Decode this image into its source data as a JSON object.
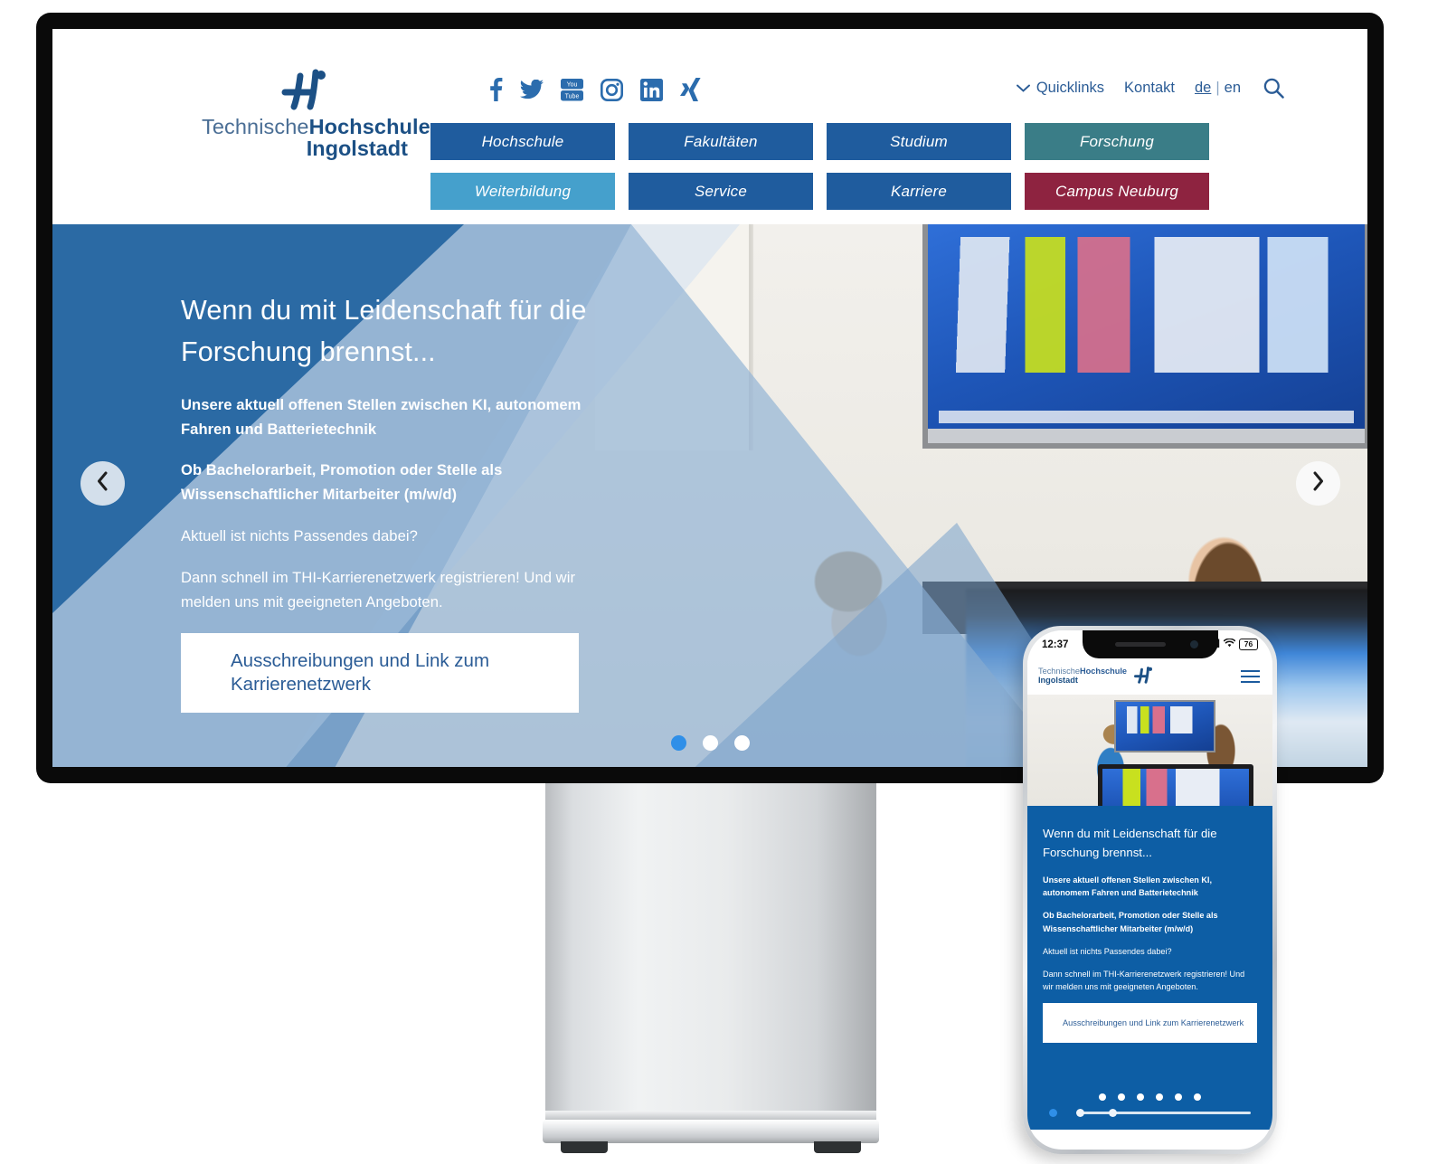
{
  "site": {
    "logo": {
      "line1_thin": "Technische",
      "line1_bold": "Hochschule",
      "line2": "Ingolstadt",
      "mark": "thi-logo-mark"
    },
    "social": [
      {
        "name": "facebook-icon",
        "label": "Facebook"
      },
      {
        "name": "twitter-icon",
        "label": "Twitter"
      },
      {
        "name": "youtube-icon",
        "label": "YouTube"
      },
      {
        "name": "instagram-icon",
        "label": "Instagram"
      },
      {
        "name": "linkedin-icon",
        "label": "LinkedIn"
      },
      {
        "name": "xing-icon",
        "label": "Xing"
      }
    ],
    "utility": {
      "quicklinks": "Quicklinks",
      "kontakt": "Kontakt",
      "lang_de": "de",
      "lang_sep": "|",
      "lang_en": "en",
      "search_icon": "search-icon",
      "chevron_icon": "chevron-down-icon"
    },
    "nav": [
      {
        "label": "Hochschule",
        "color": "#1f5c9e"
      },
      {
        "label": "Fakultäten",
        "color": "#1f5c9e"
      },
      {
        "label": "Studium",
        "color": "#1f5c9e"
      },
      {
        "label": "Forschung",
        "color": "#3a7d87"
      },
      {
        "label": "Weiterbildung",
        "color": "#45a0cc"
      },
      {
        "label": "Service",
        "color": "#1f5c9e"
      },
      {
        "label": "Karriere",
        "color": "#1f5c9e"
      },
      {
        "label": "Campus Neuburg",
        "color": "#8e2340"
      }
    ]
  },
  "hero": {
    "title": "Wenn du mit Leidenschaft für die Forschung brennst...",
    "lead": "Unsere aktuell offenen Stellen zwischen KI, autonomem Fahren und Batterietechnik",
    "para1": "Ob Bachelorarbeit, Promotion oder Stelle als Wissenschaftlicher Mitarbeiter (m/w/d)",
    "para2": "Aktuell ist nichts Passendes dabei?",
    "para3": "Dann schnell im THI-Karrierenetzwerk registrieren! Und wir melden uns mit geeigneten Angeboten.",
    "cta": "Ausschreibungen und Link zum Karrierenetzwerk",
    "prev_icon": "chevron-left-icon",
    "next_icon": "chevron-right-icon",
    "dots_total": 3,
    "dot_active_index": 0,
    "accent_active": "#2f8fe8"
  },
  "phone": {
    "status": {
      "time": "12:37",
      "signal_icon": "cellular-signal-icon",
      "wifi_icon": "wifi-icon",
      "battery": "76"
    },
    "header": {
      "logo_thin": "Technische",
      "logo_bold": "Hochschule",
      "logo_line2": "Ingolstadt",
      "menu_icon": "hamburger-menu-icon"
    },
    "hero": {
      "title": "Wenn du mit Leidenschaft für die Forschung brennst...",
      "lead": "Unsere aktuell offenen Stellen zwischen KI, autonomem Fahren und Batterietechnik",
      "para1": "Ob Bachelorarbeit, Promotion oder Stelle als Wissenschaftlicher Mitarbeiter (m/w/d)",
      "para2": "Aktuell ist nichts Passendes dabei?",
      "para3": "Dann schnell im THI-Karrierenetzwerk registrieren! Und wir melden uns mit geeigneten Angeboten.",
      "cta": "Ausschreibungen und Link zum Karrierenetzwerk",
      "dots_total": 6
    }
  }
}
